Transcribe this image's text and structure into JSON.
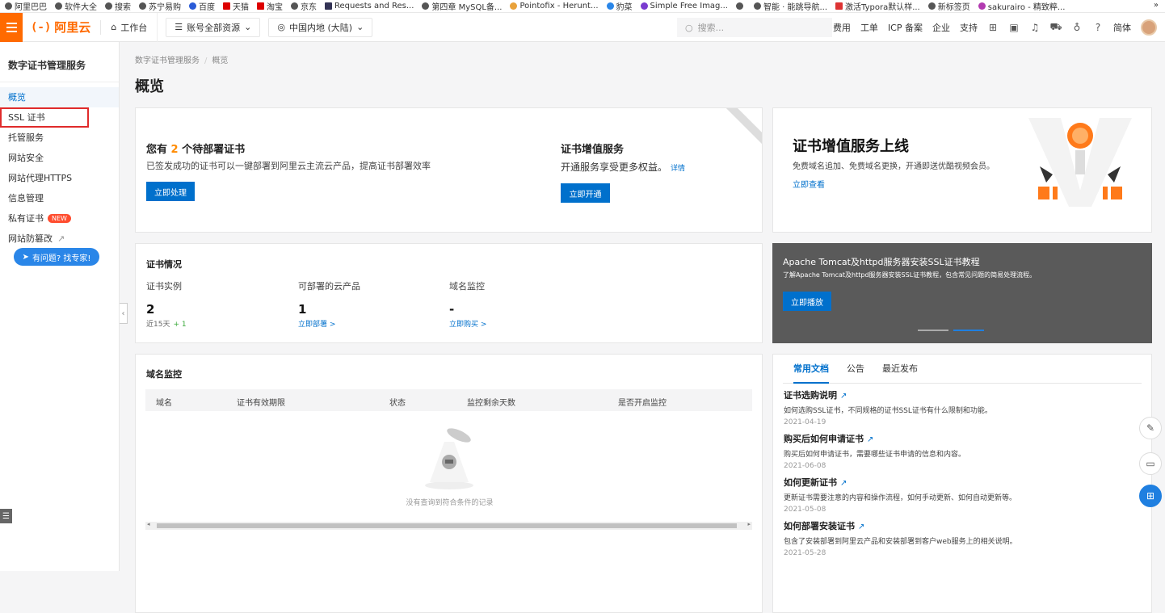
{
  "bookmarks": [
    "阿里巴巴",
    "软件大全",
    "搜索",
    "苏宁易购",
    "百度",
    "天猫",
    "淘宝",
    "京东",
    "Requests and Res...",
    "第四章 MySQL备...",
    "Pointofix - Herunt...",
    "豹菜",
    "Simple Free Imag...",
    "",
    "智能 · 能跳导航...",
    "激活Typora默认样...",
    "新标签页",
    "sakurairo - 精致粹..."
  ],
  "bookmarks_more": "»",
  "topbar": {
    "logo_text": "阿里云",
    "logo_mark": "(-)",
    "workbench": "工作台",
    "account_scope": "账号全部资源",
    "region": "中国内地 (大陆)",
    "search_placeholder": "搜索...",
    "links": [
      "费用",
      "工单",
      "ICP 备案",
      "企业",
      "支持"
    ],
    "lang": "简体"
  },
  "sidebar": {
    "title": "数字证书管理服务",
    "items": [
      "概览",
      "SSL 证书",
      "托管服务",
      "网站安全",
      "网站代理HTTPS",
      "信息管理",
      "私有证书",
      "网站防篡改"
    ],
    "new_badge": "NEW",
    "expert_btn": "有问题? 找专家!"
  },
  "breadcrumb": [
    "数字证书管理服务",
    "概览"
  ],
  "page_title": "概览",
  "pending": {
    "title_pre": "您有",
    "count": "2",
    "title_post": "个待部署证书",
    "desc": "已签发成功的证书可以一键部署到阿里云主流云产品，提高证书部署效率",
    "button": "立即处理"
  },
  "vas": {
    "title": "证书增值服务",
    "desc": "开通服务享受更多权益。",
    "detail": "详情",
    "button": "立即开通"
  },
  "banner": {
    "title": "证书增值服务上线",
    "desc": "免费域名追加、免费域名更换，开通即送优酷视频会员。",
    "link": "立即查看"
  },
  "status": {
    "title": "证书情况",
    "cols": [
      {
        "label": "证书实例",
        "value": "2",
        "sub": "近15天",
        "plus": "+ 1"
      },
      {
        "label": "可部署的云产品",
        "value": "1",
        "sub": "立即部署 >"
      },
      {
        "label": "域名监控",
        "value": "-",
        "sub": "立即购买 >"
      }
    ]
  },
  "promo": {
    "title": "Apache Tomcat及httpd服务器安装SSL证书教程",
    "desc": "了解Apache Tomcat及httpd服务器安装SSL证书教程，包含常见问题的简易处理流程。",
    "button": "立即播放"
  },
  "domain": {
    "title": "域名监控",
    "headers": [
      "域名",
      "证书有效期限",
      "状态",
      "监控剩余天数",
      "是否开启监控"
    ],
    "empty": "没有查询到符合条件的记录"
  },
  "docs": {
    "tabs": [
      "常用文档",
      "公告",
      "最近发布"
    ],
    "items": [
      {
        "title": "证书选购说明",
        "desc": "如何选购SSL证书，不同规格的证书SSL证书有什么限制和功能。",
        "date": "2021-04-19"
      },
      {
        "title": "购买后如何申请证书",
        "desc": "购买后如何申请证书，需要哪些证书申请的信息和内容。",
        "date": "2021-06-08"
      },
      {
        "title": "如何更新证书",
        "desc": "更新证书需要注意的内容和操作流程，如何手动更新、如何自动更新等。",
        "date": "2021-05-08"
      },
      {
        "title": "如何部署安装证书",
        "desc": "包含了安装部署到阿里云产品和安装部署到客户web服务上的相关说明。",
        "date": "2021-05-28"
      }
    ]
  }
}
